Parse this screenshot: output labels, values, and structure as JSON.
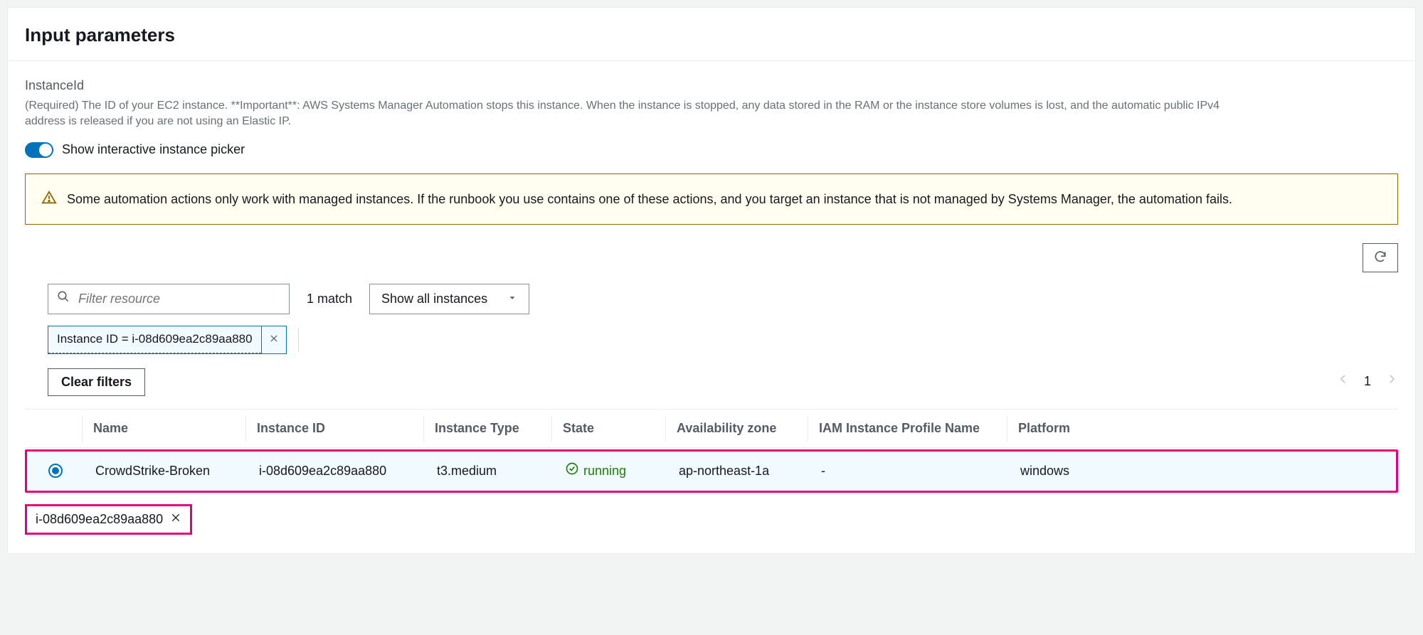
{
  "panel": {
    "title": "Input parameters"
  },
  "field": {
    "label": "InstanceId",
    "description": "(Required) The ID of your EC2 instance. **Important**: AWS Systems Manager Automation stops this instance. When the instance is stopped, any data stored in the RAM or the instance store volumes is lost, and the automatic public IPv4 address is released if you are not using an Elastic IP."
  },
  "toggle": {
    "label": "Show interactive instance picker"
  },
  "alert": {
    "text": "Some automation actions only work with managed instances. If the runbook you use contains one of these actions, and you target an instance that is not managed by Systems Manager, the automation fails."
  },
  "search": {
    "placeholder": "Filter resource",
    "match_text": "1 match",
    "dropdown_label": "Show all instances"
  },
  "filter_chip": {
    "label": "Instance ID = i-08d609ea2c89aa880"
  },
  "clear_filters_label": "Clear filters",
  "pager": {
    "current": "1"
  },
  "table": {
    "headers": {
      "name": "Name",
      "instance_id": "Instance ID",
      "instance_type": "Instance Type",
      "state": "State",
      "az": "Availability zone",
      "iam": "IAM Instance Profile Name",
      "platform": "Platform"
    },
    "row": {
      "name": "CrowdStrike-Broken",
      "instance_id": "i-08d609ea2c89aa880",
      "instance_type": "t3.medium",
      "state": "running",
      "az": "ap-northeast-1a",
      "iam": "-",
      "platform": "windows"
    }
  },
  "selected_token": {
    "label": "i-08d609ea2c89aa880"
  }
}
